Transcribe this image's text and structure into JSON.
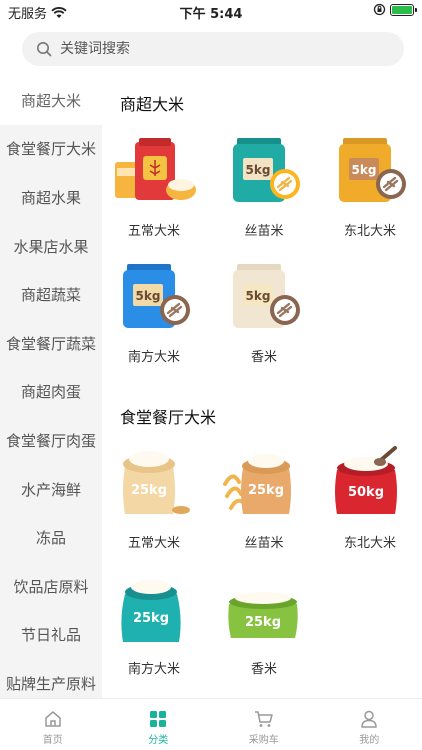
{
  "status_bar": {
    "carrier": "无服务",
    "time": "下午 5:44"
  },
  "search": {
    "placeholder": "关键词搜索"
  },
  "sidebar": {
    "items": [
      {
        "label": "商超大米"
      },
      {
        "label": "食堂餐厅大米"
      },
      {
        "label": "商超水果"
      },
      {
        "label": "水果店水果"
      },
      {
        "label": "商超蔬菜"
      },
      {
        "label": "食堂餐厅蔬菜"
      },
      {
        "label": "商超肉蛋"
      },
      {
        "label": "食堂餐厅肉蛋"
      },
      {
        "label": "水产海鲜"
      },
      {
        "label": "冻品"
      },
      {
        "label": "饮品店原料"
      },
      {
        "label": "节日礼品"
      },
      {
        "label": "贴牌生产原料"
      }
    ]
  },
  "sections": [
    {
      "title": "商超大米",
      "products": [
        {
          "name": "五常大米"
        },
        {
          "name": "丝苗米",
          "weight": "5kg"
        },
        {
          "name": "东北大米",
          "weight": "5kg"
        },
        {
          "name": "南方大米",
          "weight": "5kg"
        },
        {
          "name": "香米",
          "weight": "5kg"
        }
      ]
    },
    {
      "title": "食堂餐厅大米",
      "products": [
        {
          "name": "五常大米",
          "weight": "25kg"
        },
        {
          "name": "丝苗米",
          "weight": "25kg"
        },
        {
          "name": "东北大米",
          "weight": "50kg"
        },
        {
          "name": "南方大米",
          "weight": "25kg"
        },
        {
          "name": "香米",
          "weight": "25kg"
        }
      ]
    }
  ],
  "tabbar": {
    "tabs": [
      {
        "label": "首页",
        "icon": "home-icon"
      },
      {
        "label": "分类",
        "icon": "grid-icon"
      },
      {
        "label": "采购车",
        "icon": "cart-icon"
      },
      {
        "label": "我的",
        "icon": "user-icon"
      }
    ]
  },
  "colors": {
    "accent": "#1ab39a",
    "sidebar_bg": "#f4f4f4",
    "battery": "#2bbd4a"
  }
}
